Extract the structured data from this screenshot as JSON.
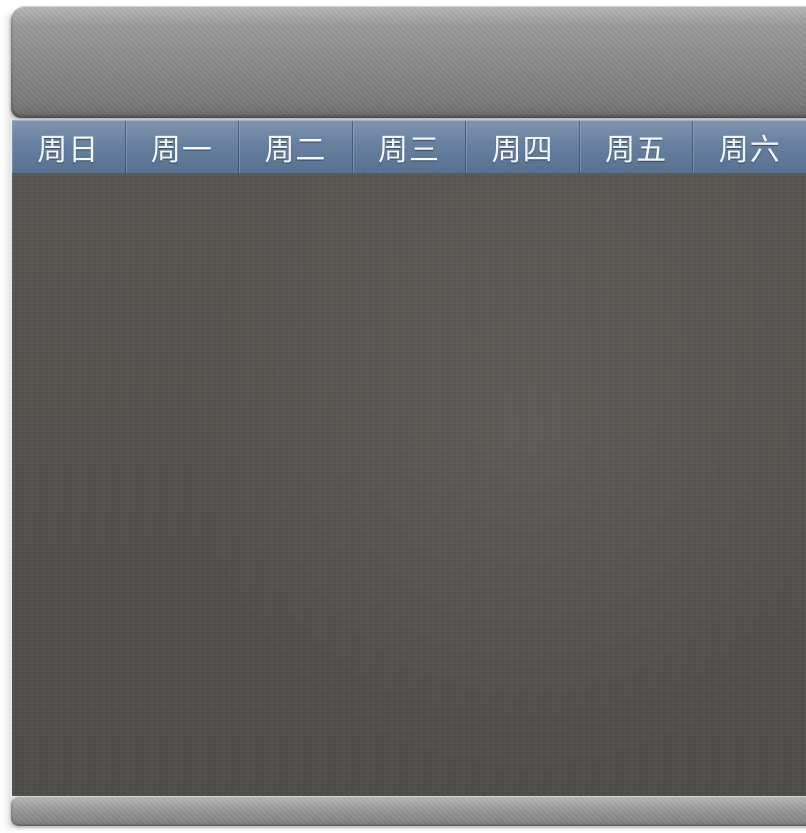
{
  "weekdays": [
    "周日",
    "周一",
    "周二",
    "周三",
    "周四",
    "周五",
    "周六"
  ]
}
